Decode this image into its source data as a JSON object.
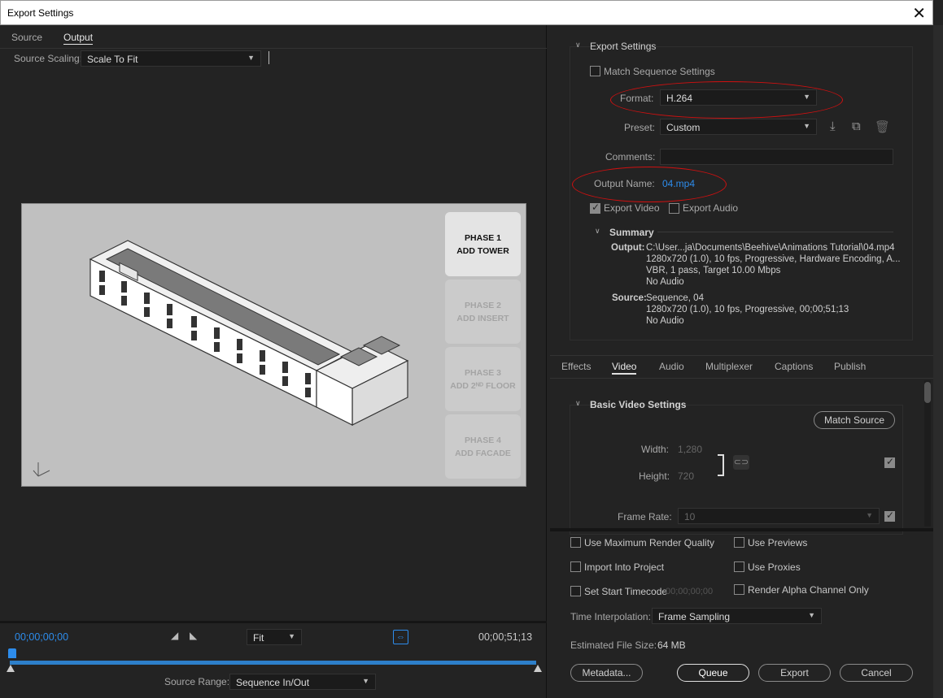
{
  "window": {
    "title": "Export Settings",
    "close": "✕"
  },
  "tabs": {
    "source": "Source",
    "output": "Output"
  },
  "source_scaling": {
    "label": "Source Scaling:",
    "value": "Scale To Fit"
  },
  "preview": {
    "phases": [
      {
        "line1": "PHASE 1",
        "line2": "ADD TOWER",
        "active": true
      },
      {
        "line1": "PHASE 2",
        "line2": "ADD INSERT",
        "active": false
      },
      {
        "line1": "PHASE 3",
        "line2": "ADD 2ᴺᴰ FLOOR",
        "active": false
      },
      {
        "line1": "PHASE 4",
        "line2": "ADD FACADE",
        "active": false
      }
    ]
  },
  "timeline": {
    "start_timecode": "00;00;00;00",
    "end_timecode": "00;00;51;13",
    "zoom": "Fit",
    "source_range_label": "Source Range:",
    "source_range_value": "Sequence In/Out"
  },
  "export_settings": {
    "section_title": "Export Settings",
    "match_sequence": "Match Sequence Settings",
    "format_label": "Format:",
    "format_value": "H.264",
    "preset_label": "Preset:",
    "preset_value": "Custom",
    "comments_label": "Comments:",
    "output_name_label": "Output Name:",
    "output_name_value": "04.mp4",
    "export_video": "Export Video",
    "export_audio": "Export Audio"
  },
  "summary": {
    "title": "Summary",
    "output_label": "Output:",
    "output_lines": [
      "C:\\User...ja\\Documents\\Beehive\\Animations Tutorial\\04.mp4",
      "1280x720 (1.0), 10 fps, Progressive, Hardware Encoding, A...",
      "VBR, 1 pass, Target 10.00 Mbps",
      "No Audio"
    ],
    "source_label": "Source:",
    "source_lines": [
      "Sequence, 04",
      "1280x720 (1.0), 10 fps, Progressive, 00;00;51;13",
      "No Audio"
    ]
  },
  "settings_tabs": [
    "Effects",
    "Video",
    "Audio",
    "Multiplexer",
    "Captions",
    "Publish"
  ],
  "video": {
    "section_title": "Basic Video Settings",
    "match_source": "Match Source",
    "width_label": "Width:",
    "width_value": "1,280",
    "height_label": "Height:",
    "height_value": "720",
    "frame_rate_label": "Frame Rate:",
    "frame_rate_value": "10"
  },
  "options": {
    "max_render_quality": "Use Maximum Render Quality",
    "use_previews": "Use Previews",
    "import_into_project": "Import Into Project",
    "use_proxies": "Use Proxies",
    "set_start_timecode": "Set Start Timecode",
    "start_timecode_value": "00;00;00;00",
    "render_alpha": "Render Alpha Channel Only",
    "time_interp_label": "Time Interpolation:",
    "time_interp_value": "Frame Sampling",
    "file_size_label": "Estimated File Size:",
    "file_size_value": "64 MB"
  },
  "buttons": {
    "metadata": "Metadata...",
    "queue": "Queue",
    "export": "Export",
    "cancel": "Cancel"
  },
  "colors": {
    "accent_blue": "#2d8ceb",
    "annotation_red": "#d01010"
  }
}
